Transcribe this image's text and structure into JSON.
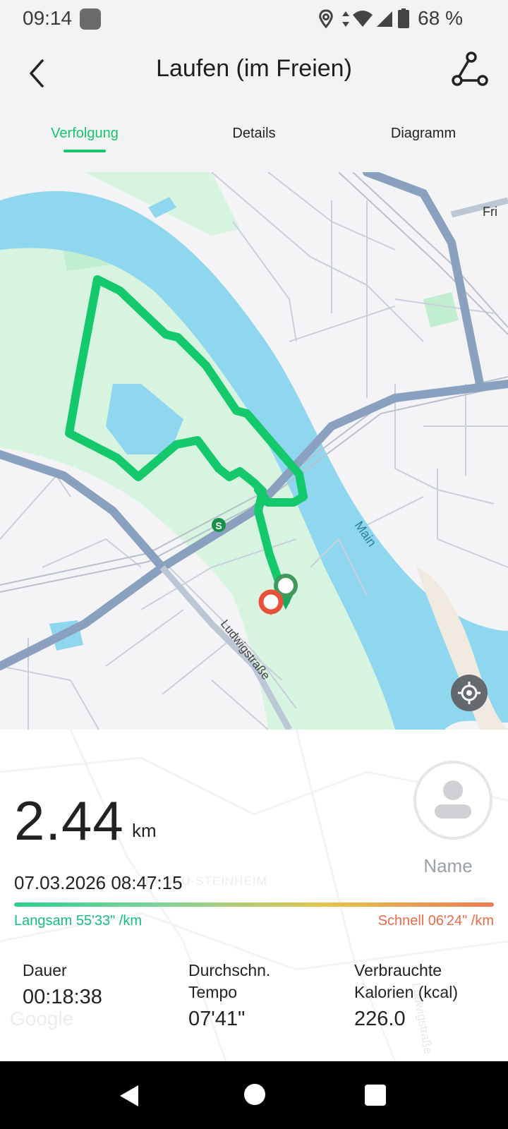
{
  "status_bar": {
    "time": "09:14",
    "battery": "68 %",
    "icons": [
      "notification-icon",
      "location-icon",
      "data-arrows-icon",
      "wifi-icon",
      "signal-icon",
      "battery-icon"
    ]
  },
  "header": {
    "title": "Laufen (im Freien)",
    "back_icon": "chevron-left-icon",
    "route_icon": "route-icon"
  },
  "tabs": [
    {
      "label": "Verfolgung",
      "active": true
    },
    {
      "label": "Details",
      "active": false
    },
    {
      "label": "Diagramm",
      "active": false
    }
  ],
  "map": {
    "labels": {
      "river": "Main",
      "street": "Ludwigstraße",
      "corner": "Fri",
      "transit": "S"
    },
    "colors": {
      "water": "#8dd6ec",
      "park": "#d6f5df",
      "route": "#14c96b",
      "road": "#8aa0bf"
    }
  },
  "summary": {
    "distance": "2.44",
    "distance_unit": "km",
    "datetime": "07.03.2026 08:47:15",
    "avatar_name": "Name",
    "pace_slow": "Langsam 55'33\" /km",
    "pace_fast": "Schnell 06'24\" /km",
    "ghost_labels": {
      "district": "HANAU-STEINHEIM",
      "street": "Ludwigstraße",
      "logo": "Google"
    }
  },
  "stats": [
    {
      "label": "Dauer",
      "value": "00:18:38"
    },
    {
      "label": "Durchschn. Tempo",
      "value": "07'41\""
    },
    {
      "label": "Verbrauchte Kalorien (kcal)",
      "value": "226.0"
    }
  ],
  "nav": {
    "back_icon": "nav-back-icon",
    "home_icon": "nav-home-icon",
    "recents_icon": "nav-recents-icon"
  }
}
